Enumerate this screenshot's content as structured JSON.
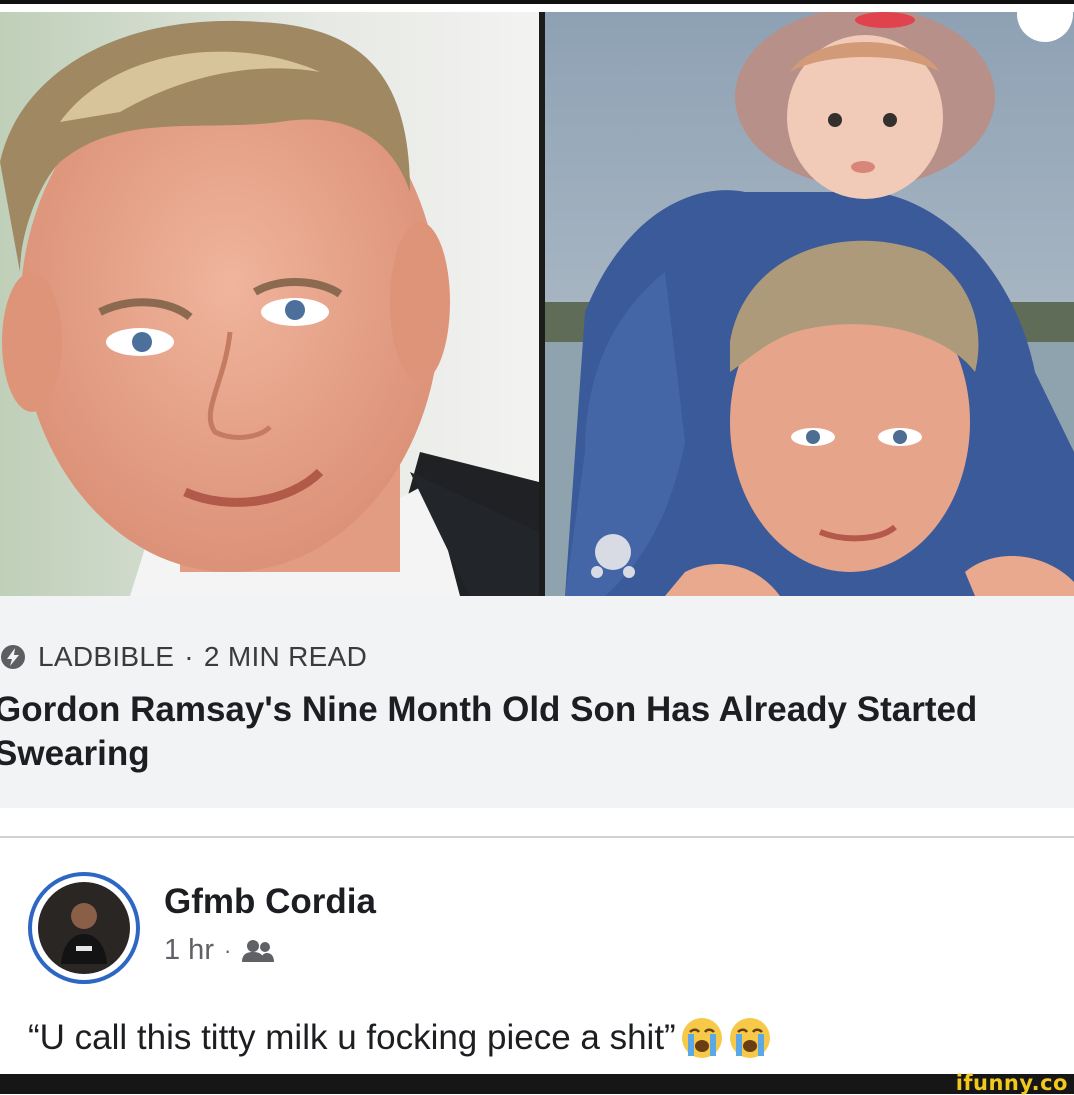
{
  "article": {
    "source": "LADBIBLE",
    "separator": "·",
    "read_time": "2 MIN READ",
    "headline": "Gordon Ramsay's Nine Month Old Son Has Already Started Swearing"
  },
  "comment": {
    "author": "Gfmb Cordia",
    "time": "1 hr",
    "separator": "·",
    "audience_icon": "friends-icon",
    "text": "“U call this titty milk u focking piece a shit”",
    "emojis": [
      "loudly-crying-face",
      "loudly-crying-face"
    ]
  },
  "watermark": "ifunny.co",
  "colors": {
    "card_background": "#f2f3f5",
    "avatar_ring": "#2d66c3",
    "watermark": "#f2c81c"
  }
}
